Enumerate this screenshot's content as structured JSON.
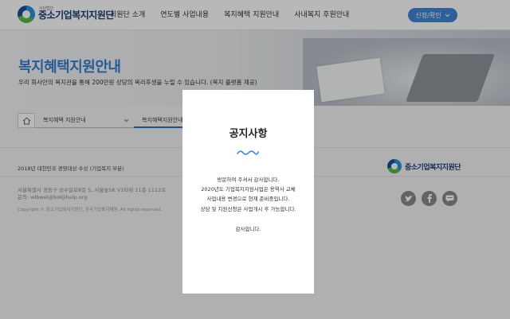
{
  "header": {
    "logo_small": "사단법인",
    "logo_text": "중소기업복지지원단",
    "nav": [
      "지원단 소개",
      "연도별 사업내용",
      "복지혜택 지원안내",
      "사내복지 후원안내"
    ],
    "login_label": "신청/확인"
  },
  "hero": {
    "title": "복지혜택지원안내",
    "description": "우리 회사만의 복지관을 통해 200만원 상당의 복리후생을 누릴 수 있습니다. (복지 플랫폼 제공)"
  },
  "breadcrumb": {
    "level1": "복지혜택 지원안내",
    "level2": "복지혜택지원안내"
  },
  "footer": {
    "award": "2018년 대한민국 경영대상 수상 (기업복지 부분)",
    "address": "서울특별시 성동구 성수일로8길 5, 서울숲SK V1타워 11층 1112호",
    "email": "문의: wlbwel@bokjihelp.org",
    "copyright": "Copyright © 중소기업복지지원단. 한국기업복지재원. All rights reserved.",
    "logo_text": "중소기업복지지원단",
    "social": [
      "twitter-icon",
      "facebook-icon",
      "kakaotalk-icon"
    ]
  },
  "modal": {
    "title": "공지사항",
    "body": [
      "방문하여 주셔서 감사합니다.",
      "2020년도 기업복지지원사업은 용역사 교체",
      "사업내용 변경으로 현재 준비중입니다.",
      "상담 및 지원신청은 사업개시 후 가능합니다."
    ],
    "thanks": "감사합니다."
  },
  "colors": {
    "accent": "#3a7fcf",
    "button": "#3f86d6",
    "overlay": "rgba(0,0,0,0.28)"
  }
}
